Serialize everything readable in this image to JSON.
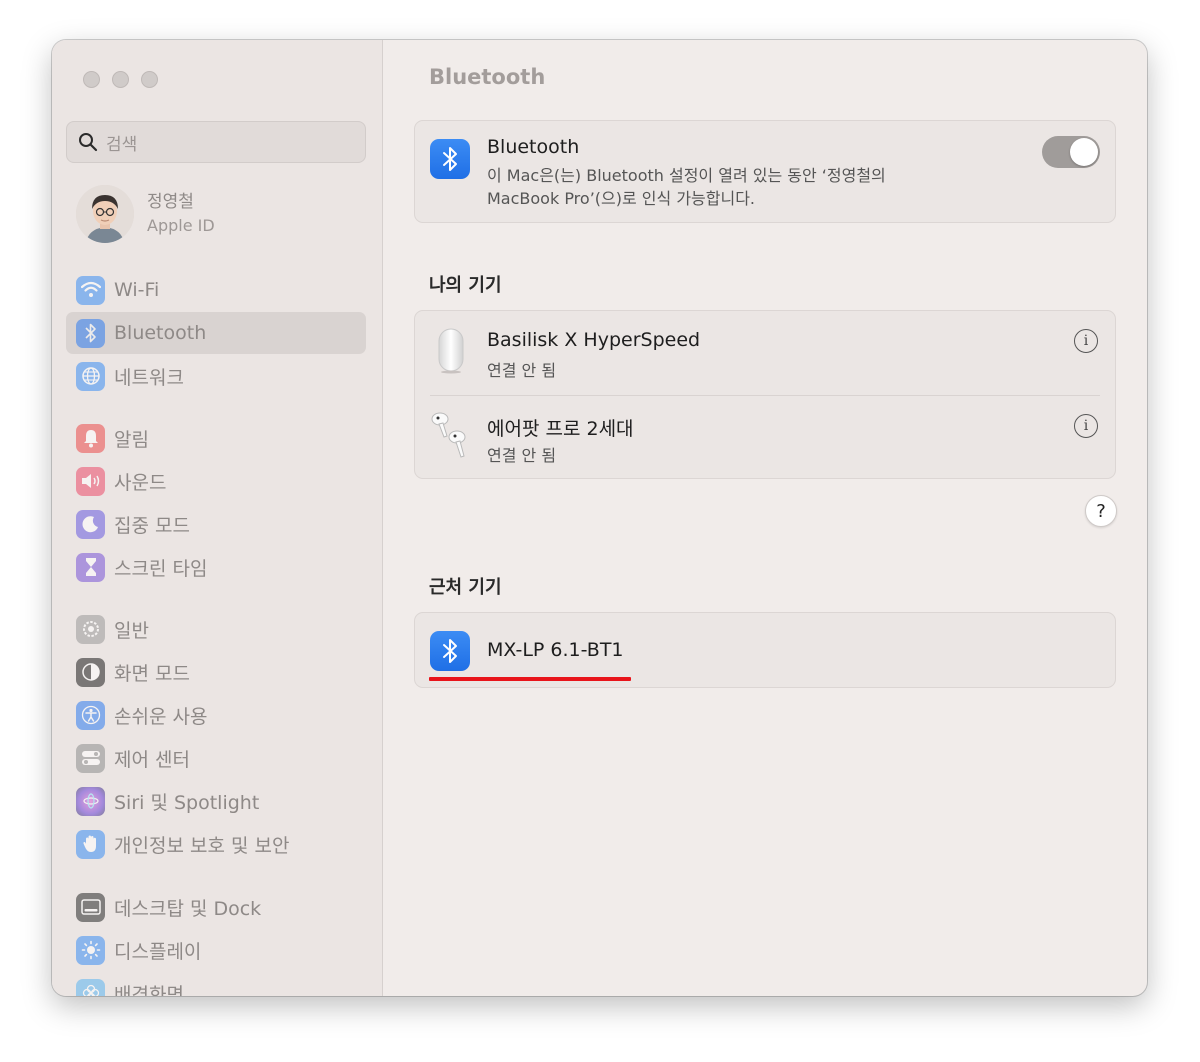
{
  "window": {
    "title": "Bluetooth"
  },
  "sidebar": {
    "search_placeholder": "검색",
    "profile": {
      "name": "정영철",
      "subtitle": "Apple ID"
    },
    "items": [
      {
        "label": "Wi-Fi",
        "icon": "wifi-icon",
        "color": "#3b8ef5"
      },
      {
        "label": "Bluetooth",
        "icon": "bluetooth-icon",
        "color": "#2f7cf0",
        "selected": true
      },
      {
        "label": "네트워크",
        "icon": "globe-icon",
        "color": "#3b8ef5"
      },
      {
        "label": "알림",
        "icon": "bell-icon",
        "color": "#ec4b4b"
      },
      {
        "label": "사운드",
        "icon": "speaker-icon",
        "color": "#ec4b6a"
      },
      {
        "label": "집중 모드",
        "icon": "moon-icon",
        "color": "#6a5ce0"
      },
      {
        "label": "스크린 타임",
        "icon": "hourglass-icon",
        "color": "#7a55d8"
      },
      {
        "label": "일반",
        "icon": "gear-icon",
        "color": "#9a9a9a"
      },
      {
        "label": "화면 모드",
        "icon": "appearance-icon",
        "color": "#1e1e1e"
      },
      {
        "label": "손쉬운 사용",
        "icon": "accessibility-icon",
        "color": "#2f7cf0"
      },
      {
        "label": "제어 센터",
        "icon": "control-center-icon",
        "color": "#8e8e8e"
      },
      {
        "label": "Siri 및 Spotlight",
        "icon": "siri-icon",
        "color": "#c04fc8"
      },
      {
        "label": "개인정보 보호 및 보안",
        "icon": "hand-icon",
        "color": "#3b8ef5"
      },
      {
        "label": "데스크탑 및 Dock",
        "icon": "dock-icon",
        "color": "#2a2a2a"
      },
      {
        "label": "디스플레이",
        "icon": "sun-icon",
        "color": "#3b8ef5"
      },
      {
        "label": "배경화면",
        "icon": "flower-icon",
        "color": "#5bb4f0"
      }
    ]
  },
  "bluetooth": {
    "label": "Bluetooth",
    "description_line1": "이 Mac은(는) Bluetooth 설정이 열려 있는 동안 ‘정영철의",
    "description_line2": "MacBook Pro’(으)로 인식 가능합니다.",
    "enabled": true
  },
  "my_devices": {
    "heading": "나의 기기",
    "devices": [
      {
        "name": "Basilisk X HyperSpeed",
        "status": "연결 안 됨",
        "icon": "mouse-icon"
      },
      {
        "name": "에어팟 프로 2세대",
        "status": "연결 안 됨",
        "icon": "airpods-icon"
      }
    ]
  },
  "help_label": "?",
  "nearby_devices": {
    "heading": "근처 기기",
    "devices": [
      {
        "name": "MX-LP 6.1-BT1",
        "icon": "bluetooth-icon"
      }
    ]
  },
  "annotation": {
    "color": "#e8141a"
  }
}
